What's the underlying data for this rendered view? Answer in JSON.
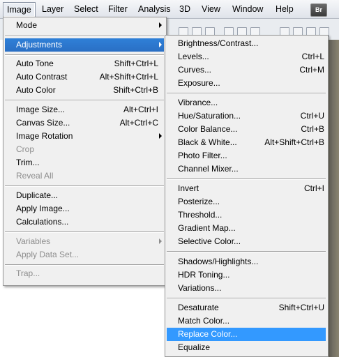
{
  "menubar": {
    "items": [
      "Image",
      "Layer",
      "Select",
      "Filter",
      "Analysis",
      "3D",
      "View",
      "Window",
      "Help"
    ],
    "bridge_badge": "Br"
  },
  "image_menu": {
    "items": [
      {
        "label": "Mode",
        "submenu": true
      },
      {
        "label": "Adjustments",
        "submenu": true,
        "highlighted": true
      },
      {
        "label": "Auto Tone",
        "shortcut": "Shift+Ctrl+L"
      },
      {
        "label": "Auto Contrast",
        "shortcut": "Alt+Shift+Ctrl+L"
      },
      {
        "label": "Auto Color",
        "shortcut": "Shift+Ctrl+B"
      },
      {
        "label": "Image Size...",
        "shortcut": "Alt+Ctrl+I"
      },
      {
        "label": "Canvas Size...",
        "shortcut": "Alt+Ctrl+C"
      },
      {
        "label": "Image Rotation",
        "submenu": true
      },
      {
        "label": "Crop",
        "disabled": true
      },
      {
        "label": "Trim..."
      },
      {
        "label": "Reveal All",
        "disabled": true
      },
      {
        "label": "Duplicate..."
      },
      {
        "label": "Apply Image..."
      },
      {
        "label": "Calculations..."
      },
      {
        "label": "Variables",
        "submenu": true,
        "disabled": true
      },
      {
        "label": "Apply Data Set...",
        "disabled": true
      },
      {
        "label": "Trap...",
        "disabled": true
      }
    ]
  },
  "adjustments_menu": {
    "items": [
      {
        "label": "Brightness/Contrast..."
      },
      {
        "label": "Levels...",
        "shortcut": "Ctrl+L"
      },
      {
        "label": "Curves...",
        "shortcut": "Ctrl+M"
      },
      {
        "label": "Exposure..."
      },
      {
        "label": "Vibrance..."
      },
      {
        "label": "Hue/Saturation...",
        "shortcut": "Ctrl+U"
      },
      {
        "label": "Color Balance...",
        "shortcut": "Ctrl+B"
      },
      {
        "label": "Black & White...",
        "shortcut": "Alt+Shift+Ctrl+B"
      },
      {
        "label": "Photo Filter..."
      },
      {
        "label": "Channel Mixer..."
      },
      {
        "label": "Invert",
        "shortcut": "Ctrl+I"
      },
      {
        "label": "Posterize..."
      },
      {
        "label": "Threshold..."
      },
      {
        "label": "Gradient Map..."
      },
      {
        "label": "Selective Color..."
      },
      {
        "label": "Shadows/Highlights..."
      },
      {
        "label": "HDR Toning..."
      },
      {
        "label": "Variations..."
      },
      {
        "label": "Desaturate",
        "shortcut": "Shift+Ctrl+U"
      },
      {
        "label": "Match Color..."
      },
      {
        "label": "Replace Color...",
        "highlighted": true
      },
      {
        "label": "Equalize"
      }
    ]
  },
  "colors": {
    "menu_bg": "#f0f0f0",
    "highlight": "#3399ff",
    "disabled_text": "#8d8d8d"
  }
}
